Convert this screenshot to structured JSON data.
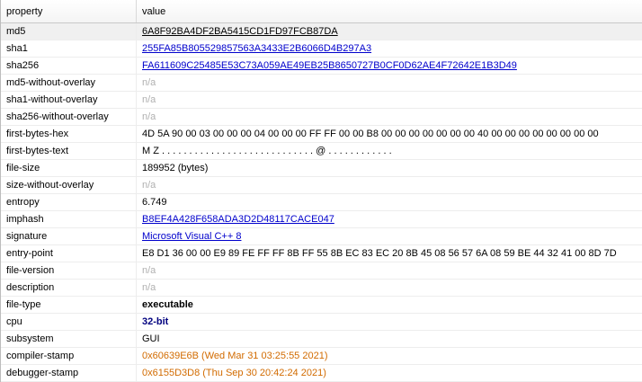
{
  "header": {
    "property_label": "property",
    "value_label": "value"
  },
  "rows": [
    {
      "property": "md5",
      "value": "6A8F92BA4DF2BA5415CD1FD97FCB87DA",
      "style": "link-dark",
      "selected": true
    },
    {
      "property": "sha1",
      "value": "255FA85B805529857563A3433E2B6066D4B297A3",
      "style": "link"
    },
    {
      "property": "sha256",
      "value": "FA611609C25485E53C73A059AE49EB25B8650727B0CF0D62AE4F72642E1B3D49",
      "style": "link"
    },
    {
      "property": "md5-without-overlay",
      "value": "n/a",
      "style": "na"
    },
    {
      "property": "sha1-without-overlay",
      "value": "n/a",
      "style": "na"
    },
    {
      "property": "sha256-without-overlay",
      "value": "n/a",
      "style": "na"
    },
    {
      "property": "first-bytes-hex",
      "value": "4D 5A 90 00 03 00 00 00 04 00 00 00 FF FF 00 00 B8 00 00 00 00 00 00 00 40 00 00 00 00 00 00 00 00",
      "style": "plain"
    },
    {
      "property": "first-bytes-text",
      "value": "M Z . . . . . . . . . . . . . . . . . . . . . . . . . . . . @ . . . . . . . . . . . .",
      "style": "plain"
    },
    {
      "property": "file-size",
      "value": "189952 (bytes)",
      "style": "plain"
    },
    {
      "property": "size-without-overlay",
      "value": "n/a",
      "style": "na"
    },
    {
      "property": "entropy",
      "value": "6.749",
      "style": "plain"
    },
    {
      "property": "imphash",
      "value": "B8EF4A428F658ADA3D2D48117CACE047",
      "style": "link"
    },
    {
      "property": "signature",
      "value": "Microsoft Visual C++ 8",
      "style": "link"
    },
    {
      "property": "entry-point",
      "value": "E8 D1 36 00 00 E9 89 FE FF FF 8B FF 55 8B EC 83 EC 20 8B 45 08 56 57 6A 08 59 BE 44 32 41 00 8D 7D",
      "style": "plain"
    },
    {
      "property": "file-version",
      "value": "n/a",
      "style": "na"
    },
    {
      "property": "description",
      "value": "n/a",
      "style": "na"
    },
    {
      "property": "file-type",
      "value": "executable",
      "style": "bold"
    },
    {
      "property": "cpu",
      "value": "32-bit",
      "style": "bold-blue"
    },
    {
      "property": "subsystem",
      "value": "GUI",
      "style": "plain"
    },
    {
      "property": "compiler-stamp",
      "value": "0x60639E6B (Wed Mar 31 03:25:55 2021)",
      "style": "orange"
    },
    {
      "property": "debugger-stamp",
      "value": "0x6155D3D8 (Thu Sep 30 20:42:24 2021)",
      "style": "orange"
    }
  ]
}
